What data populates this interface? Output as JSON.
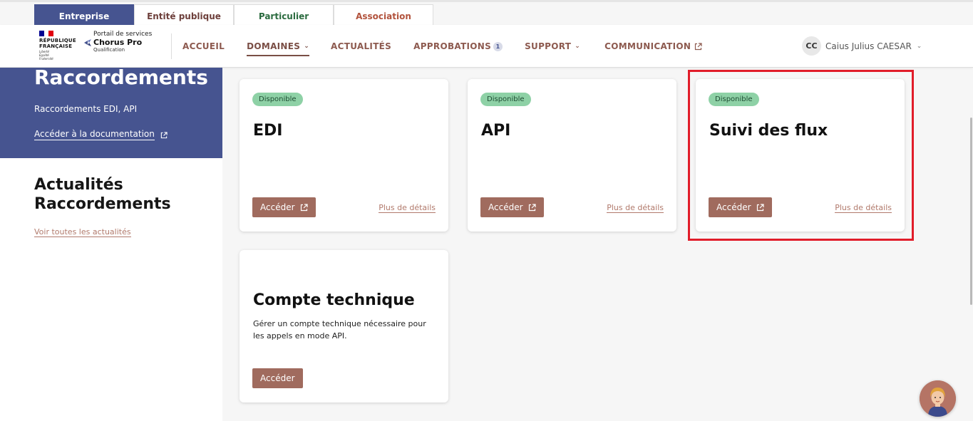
{
  "audience_tabs": [
    {
      "label": "Entreprise",
      "active": true
    },
    {
      "label": "Entité publique",
      "active": false
    },
    {
      "label": "Particulier",
      "active": false
    },
    {
      "label": "Association",
      "active": false
    }
  ],
  "logo": {
    "rf_line1": "RÉPUBLIQUE",
    "rf_line2": "FRANÇAISE",
    "motto": [
      "Liberté",
      "Égalité",
      "Fraternité"
    ],
    "portail": "Portail de services",
    "brand": "Chorus Pro",
    "env": "Qualification"
  },
  "nav": {
    "items": [
      {
        "label": "ACCUEIL"
      },
      {
        "label": "DOMAINES"
      },
      {
        "label": "ACTUALITÉS"
      },
      {
        "label": "APPROBATIONS",
        "badge": "1"
      },
      {
        "label": "SUPPORT"
      },
      {
        "label": "COMMUNICATION"
      }
    ]
  },
  "user": {
    "initials": "CC",
    "name": "Caius Julius CAESAR"
  },
  "left": {
    "title": "Raccordements",
    "subtitle": "Raccordements EDI, API",
    "doc_link": "Accéder à la documentation",
    "news_title_1": "Actualités",
    "news_title_2": "Raccordements",
    "news_link": "Voir toutes les actualités"
  },
  "cards": [
    {
      "badge": "Disponible",
      "title": "EDI",
      "button": "Accéder",
      "details": "Plus de détails"
    },
    {
      "badge": "Disponible",
      "title": "API",
      "button": "Accéder",
      "details": "Plus de détails"
    },
    {
      "badge": "Disponible",
      "title": "Suivi des flux",
      "button": "Accéder",
      "details": "Plus de détails"
    },
    {
      "title": "Compte technique",
      "description": "Gérer un compte technique nécessaire pour les appels en mode API.",
      "button": "Accéder"
    }
  ],
  "colors": {
    "primary_blue": "#465490",
    "accent_brown": "#a06b5e",
    "badge_green": "#8ed1a6",
    "highlight_red": "#e11d2a"
  }
}
